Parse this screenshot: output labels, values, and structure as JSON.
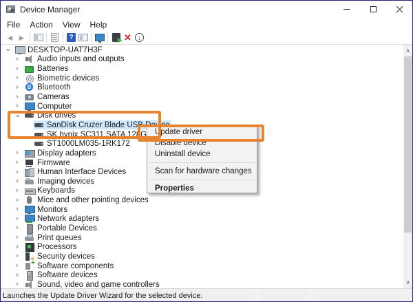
{
  "window": {
    "title": "Device Manager",
    "controls": [
      {
        "name": "minimize-button",
        "glyph": "minimize"
      },
      {
        "name": "maximize-button",
        "glyph": "maximize"
      },
      {
        "name": "close-button",
        "glyph": "close"
      }
    ]
  },
  "menu_bar": {
    "items": [
      "File",
      "Action",
      "View",
      "Help"
    ]
  },
  "toolbar": {
    "buttons": [
      {
        "name": "back-button",
        "icon": "back-icon",
        "cls": "t-back",
        "sep_after": false
      },
      {
        "name": "forward-button",
        "icon": "forward-icon",
        "cls": "t-forward",
        "sep_after": true
      },
      {
        "name": "show-console-tree-button",
        "icon": "console-tree-icon",
        "cls": "t-panel1",
        "sep_after": true
      },
      {
        "name": "properties-button",
        "icon": "properties-doc-icon",
        "cls": "t-doc",
        "sep_after": true
      },
      {
        "name": "help-button",
        "icon": "help-icon",
        "cls": "t-help",
        "glyph": "?",
        "sep_after": false
      },
      {
        "name": "show-action-pane-button",
        "icon": "action-pane-icon",
        "cls": "t-panel2",
        "sep_after": true
      },
      {
        "name": "devices-by-type-button",
        "icon": "monitor-icon",
        "cls": "t-monitor",
        "sep_after": true
      },
      {
        "name": "scan-hardware-changes-button",
        "icon": "scan-hardware-icon",
        "cls": "t-scan",
        "sep_after": false
      },
      {
        "name": "uninstall-device-button",
        "icon": "red-x-icon",
        "cls": "t-x",
        "sep_after": false
      },
      {
        "name": "disable-device-button",
        "icon": "circled-down-arrow-icon",
        "cls": "t-disable",
        "sep_after": false
      }
    ]
  },
  "tree": {
    "items": [
      {
        "label": "DESKTOP-UAT7H3F",
        "level": 0,
        "state": "expanded",
        "icon": "computer",
        "selected": false
      },
      {
        "label": "Audio inputs and outputs",
        "level": 1,
        "state": "collapsed",
        "icon": "audio",
        "selected": false
      },
      {
        "label": "Batteries",
        "level": 1,
        "state": "collapsed",
        "icon": "battery",
        "selected": false
      },
      {
        "label": "Biometric devices",
        "level": 1,
        "state": "collapsed",
        "icon": "fingerprint",
        "selected": false
      },
      {
        "label": "Bluetooth",
        "level": 1,
        "state": "collapsed",
        "icon": "bluetooth",
        "selected": false
      },
      {
        "label": "Cameras",
        "level": 1,
        "state": "collapsed",
        "icon": "camera",
        "selected": false
      },
      {
        "label": "Computer",
        "level": 1,
        "state": "collapsed",
        "icon": "monitor",
        "selected": false
      },
      {
        "label": "Disk drives",
        "level": 1,
        "state": "expanded",
        "icon": "disk",
        "selected": false
      },
      {
        "label": "SanDisk Cruzer Blade USB Device",
        "level": 2,
        "state": "none",
        "icon": "disk",
        "selected": true
      },
      {
        "label": "SK hynix SC311 SATA 128GB",
        "level": 2,
        "state": "none",
        "icon": "disk",
        "selected": false
      },
      {
        "label": "ST1000LM035-1RK172",
        "level": 2,
        "state": "none",
        "icon": "disk",
        "selected": false
      },
      {
        "label": "Display adapters",
        "level": 1,
        "state": "collapsed",
        "icon": "display-adapter",
        "selected": false
      },
      {
        "label": "Firmware",
        "level": 1,
        "state": "collapsed",
        "icon": "firmware",
        "selected": false
      },
      {
        "label": "Human Interface Devices",
        "level": 1,
        "state": "collapsed",
        "icon": "hid",
        "selected": false
      },
      {
        "label": "Imaging devices",
        "level": 1,
        "state": "collapsed",
        "icon": "imaging",
        "selected": false
      },
      {
        "label": "Keyboards",
        "level": 1,
        "state": "collapsed",
        "icon": "keyboard",
        "selected": false
      },
      {
        "label": "Mice and other pointing devices",
        "level": 1,
        "state": "collapsed",
        "icon": "mouse",
        "selected": false
      },
      {
        "label": "Monitors",
        "level": 1,
        "state": "collapsed",
        "icon": "monitor",
        "selected": false
      },
      {
        "label": "Network adapters",
        "level": 1,
        "state": "collapsed",
        "icon": "network",
        "selected": false
      },
      {
        "label": "Portable Devices",
        "level": 1,
        "state": "collapsed",
        "icon": "portable",
        "selected": false
      },
      {
        "label": "Print queues",
        "level": 1,
        "state": "collapsed",
        "icon": "printer",
        "selected": false
      },
      {
        "label": "Processors",
        "level": 1,
        "state": "collapsed",
        "icon": "processor",
        "selected": false
      },
      {
        "label": "Security devices",
        "level": 1,
        "state": "collapsed",
        "icon": "security",
        "selected": false
      },
      {
        "label": "Software components",
        "level": 1,
        "state": "collapsed",
        "icon": "software-component",
        "selected": false
      },
      {
        "label": "Software devices",
        "level": 1,
        "state": "collapsed",
        "icon": "software-device",
        "selected": false
      },
      {
        "label": "Sound, video and game controllers",
        "level": 1,
        "state": "collapsed",
        "icon": "sound",
        "selected": false
      }
    ]
  },
  "context_menu": {
    "items": [
      {
        "type": "item",
        "label": "Update driver",
        "bold": false,
        "highlighted": true
      },
      {
        "type": "item",
        "label": "Disable device",
        "bold": false,
        "highlighted": false
      },
      {
        "type": "item",
        "label": "Uninstall device",
        "bold": false,
        "highlighted": false
      },
      {
        "type": "separator"
      },
      {
        "type": "item",
        "label": "Scan for hardware changes",
        "bold": false,
        "highlighted": false
      },
      {
        "type": "separator"
      },
      {
        "type": "item",
        "label": "Properties",
        "bold": true,
        "highlighted": false
      }
    ]
  },
  "status_bar": {
    "text": "Launches the Update Driver Wizard for the selected device."
  },
  "colors": {
    "highlight_orange": "#e8842f",
    "selection_blue": "#cde8ff",
    "window_border": "#22227a",
    "menu_background": "#f2f2f2",
    "status_background": "#f0f0f0"
  }
}
